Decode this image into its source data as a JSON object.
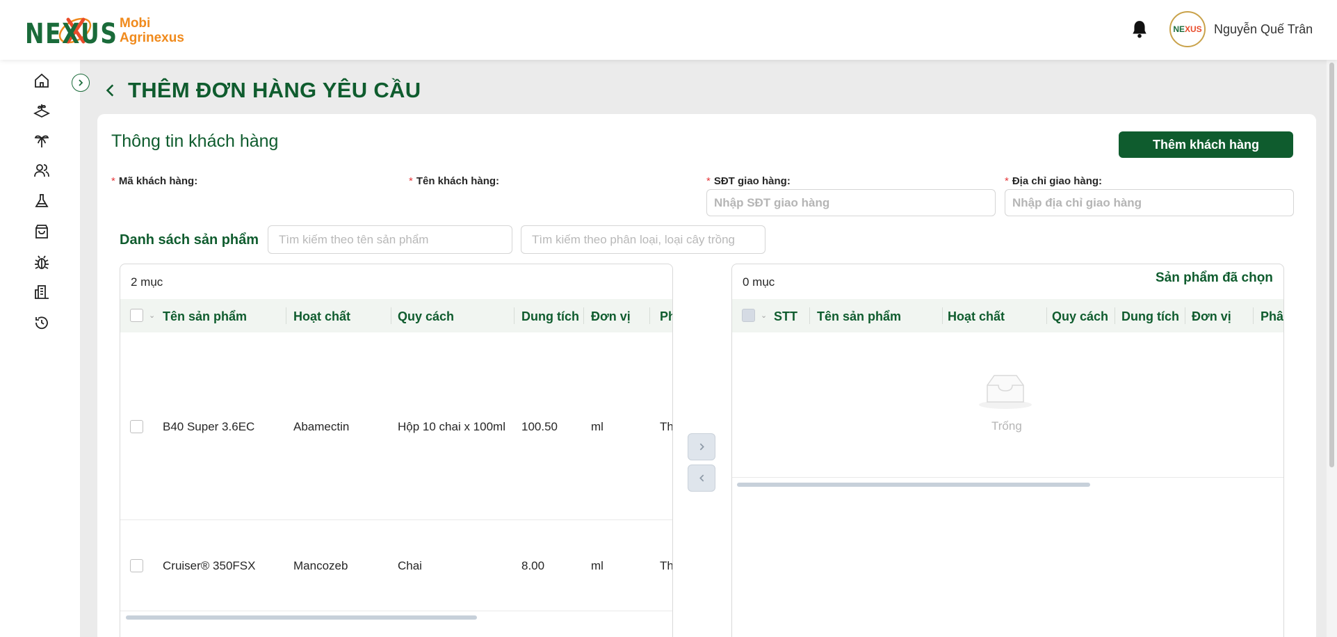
{
  "brand": {
    "logo_text": "NEXUS",
    "name_line1": "Mobi",
    "name_line2": "Agrinexus",
    "avatar_text_a": "NE",
    "avatar_text_b": "XUS"
  },
  "user": {
    "name": "Nguyễn Quế Trân"
  },
  "page": {
    "title": "THÊM ĐƠN HÀNG YÊU CẦU"
  },
  "customer": {
    "section_title": "Thông tin khách hàng",
    "add_button": "Thêm khách hàng",
    "fields": {
      "code_label": "Mã khách hàng:",
      "name_label": "Tên khách hàng:",
      "phone_label": "SĐT giao hàng:",
      "phone_placeholder": "Nhập SĐT giao hàng",
      "address_label": "Địa chỉ giao hàng:",
      "address_placeholder": "Nhập địa chỉ giao hàng"
    },
    "required_mark": "*"
  },
  "products": {
    "title": "Danh sách sản phẩm",
    "search_name_placeholder": "Tìm kiếm theo tên sản phẩm",
    "search_type_placeholder": "Tìm kiếm theo phân loại, loại cây trồng",
    "count": "2 mục",
    "columns": [
      "Tên sản phẩm",
      "Hoạt chất",
      "Quy cách",
      "Dung tích",
      "Đơn vị",
      "Ph"
    ],
    "rows": [
      {
        "name": "B40 Super 3.6EC",
        "ingredient": "Abamectin",
        "spec": "Hộp 10 chai x 100ml",
        "volume": "100.50",
        "unit": "ml",
        "extra": "Th"
      },
      {
        "name": "Cruiser® 350FSX",
        "ingredient": "Mancozeb",
        "spec": "Chai",
        "volume": "8.00",
        "unit": "ml",
        "extra": "Th"
      }
    ]
  },
  "selected": {
    "count": "0 mục",
    "title": "Sản phẩm đã chọn",
    "columns": [
      "STT",
      "Tên sản phẩm",
      "Hoạt chất",
      "Quy cách",
      "Dung tích",
      "Đơn vị",
      "Phân"
    ],
    "empty_text": "Trống"
  },
  "transfer": {
    "right_icon": "chevron-right-icon",
    "left_icon": "chevron-left-icon"
  },
  "colors": {
    "primary": "#0f5c2e",
    "accent": "#f08a1c",
    "required": "#e5383b"
  }
}
